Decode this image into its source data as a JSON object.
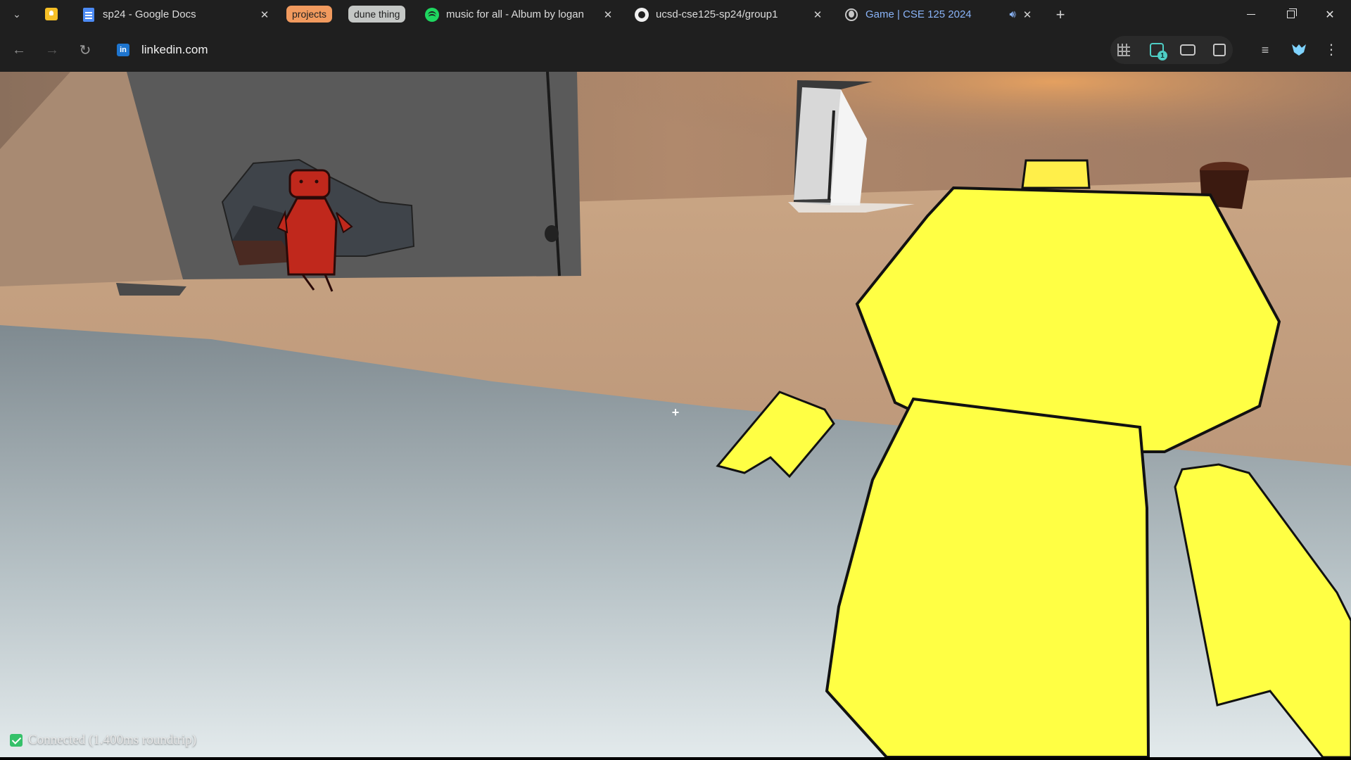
{
  "browser": {
    "tabs": [
      {
        "title": "sp24 - Google Docs",
        "icon": "google-docs-icon"
      },
      {
        "title": "music for all - Album by logan",
        "icon": "spotify-icon"
      },
      {
        "title": "ucsd-cse125-sp24/group1",
        "icon": "github-icon"
      },
      {
        "title": "Game | CSE 125 2024",
        "icon": "globe-icon",
        "active": true,
        "playing_audio": true
      }
    ],
    "tab_groups": [
      {
        "label": "projects",
        "color": "#f19a5e"
      },
      {
        "label": "dune thing",
        "color": "#c4c7c5"
      }
    ],
    "pinned_tab_icon": "google-keep-icon",
    "new_tab_symbol": "+",
    "address": {
      "url": "linkedin.com",
      "site_icon_text": "in"
    },
    "window_controls": {
      "close_symbol": "✕"
    },
    "extensions": [
      "grid-icon",
      "magnifier-icon",
      "glasses-icon",
      "puzzle-icon",
      "queue-icon",
      "shield-icon",
      "menu-icon"
    ],
    "extension_badge": "1"
  },
  "game": {
    "crosshair": "+",
    "status": {
      "text": "Connected (1.400ms roundtrip)",
      "color": "#35c16a"
    },
    "player_color": "#ffff44",
    "enemy_color": "#c0281c"
  }
}
